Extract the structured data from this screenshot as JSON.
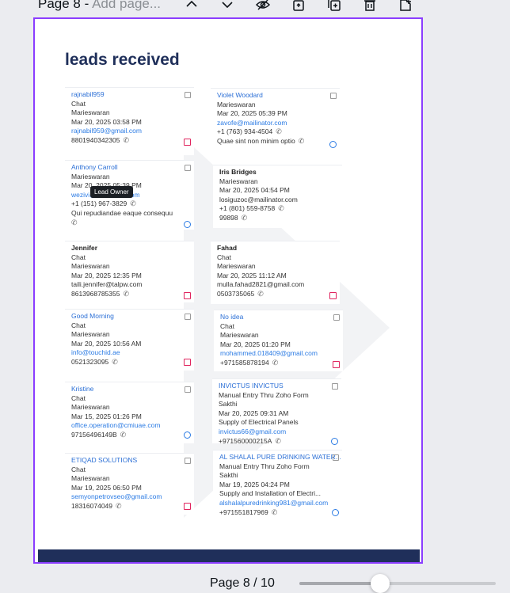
{
  "header": {
    "page_prefix": "Page 8 - ",
    "page_title_placeholder": "Add page..."
  },
  "toolbar": {
    "icons": [
      "chevron-up-icon",
      "chevron-down-icon",
      "hide-icon",
      "lock-icon",
      "duplicate-page-icon",
      "delete-icon",
      "add-page-icon"
    ]
  },
  "canvas": {
    "title": "leads received",
    "tooltip": "Lead Owner",
    "left_cards": [
      {
        "name": "rajnabil959",
        "lines": [
          "Chat",
          "Marieswaran",
          "Mar 20, 2025 03:58 PM"
        ],
        "email": "rajnabil959@gmail.com",
        "phone": "8801940342305",
        "action": "red"
      },
      {
        "name": "Anthony Carroll",
        "lines": [
          "Marieswaran",
          "Mar 20, 2025 05:39 PM"
        ],
        "email": "wezivi@mailinator.com",
        "phone": "+1 (151) 967-3829",
        "extra": "Qui repudiandae eaque consequu",
        "action": "blue"
      },
      {
        "name": "Jennifer",
        "dark": true,
        "lines": [
          "Chat",
          "Marieswaran",
          "Mar 20, 2025 12:35 PM",
          "taili.jennifer@talpw.com"
        ],
        "phone": "8613968785355",
        "action": "red"
      },
      {
        "name": "Good Morning",
        "lines": [
          "Chat",
          "Marieswaran",
          "Mar 20, 2025 10:56 AM"
        ],
        "email": "info@touchid.ae",
        "phone": "0521323095",
        "action": "red"
      },
      {
        "name": "Kristine",
        "lines": [
          "Chat",
          "Marieswaran",
          "Mar 15, 2025 01:26 PM"
        ],
        "email": "office.operation@cmiuae.com",
        "phone": "97156496149B",
        "action": "blue"
      },
      {
        "name": "ETIQAD SOLUTIONS",
        "lines": [
          "Chat",
          "Marieswaran",
          "Mar 19, 2025 06:50 PM"
        ],
        "email": "semyonpetrovseo@gmail.com",
        "phone": "18316074049",
        "action": "red"
      }
    ],
    "right_cards": [
      {
        "name": "Violet Woodard",
        "lines": [
          "Marieswaran",
          "Mar 20, 2025 05:39 PM"
        ],
        "email": "zavofe@mailinator.com",
        "phone": "+1 (763) 934-4504",
        "extra": "Quae sint non minim optio",
        "action": "blue"
      },
      {
        "name": "Iris Bridges",
        "dark": true,
        "lines": [
          "Marieswaran",
          "Mar 20, 2025 04:54 PM",
          "losiguzoc@mailinator.com",
          "+1 (801) 559-8758"
        ],
        "phone": "99898",
        "action": "none"
      },
      {
        "name": "Fahad",
        "dark": true,
        "lines": [
          "Chat",
          "Marieswaran",
          "Mar 20, 2025 11:12 AM",
          "mulla.fahad2821@gmail.com"
        ],
        "phone": "0503735065",
        "action": "red"
      },
      {
        "name": "No idea",
        "lines": [
          "Chat",
          "Marieswaran",
          "Mar 20, 2025 01:20 PM"
        ],
        "email": "mohammed.018409@gmail.com",
        "phone": "+971585878194",
        "action": "red"
      },
      {
        "name": "INVICTUS INVICTUS",
        "lines": [
          "Manual Entry Thru Zoho Form",
          "Sakthi",
          "Mar 20, 2025 09:31 AM",
          "Supply of Electrical Panels"
        ],
        "email": "invictus66@gmail.com",
        "phone": "+971560000215A",
        "action": "blue"
      },
      {
        "name": "AL SHALAL PURE DRINKING WATER...",
        "lines": [
          "Manual Entry Thru Zoho Form",
          "Sakthi",
          "Mar 19, 2025 04:24 PM",
          "Supply and Installation of Electri..."
        ],
        "email": "alshalalpuredrinking981@gmail.com",
        "phone": "+971551817969",
        "action": "blue"
      }
    ]
  },
  "footer": {
    "page_indicator": "Page 8 / 10",
    "zoom_fraction": 0.41
  },
  "colors": {
    "selection": "#8b3dff",
    "title": "#1f2f5a",
    "link": "#2b7be4",
    "action_red": "#e0245e"
  }
}
